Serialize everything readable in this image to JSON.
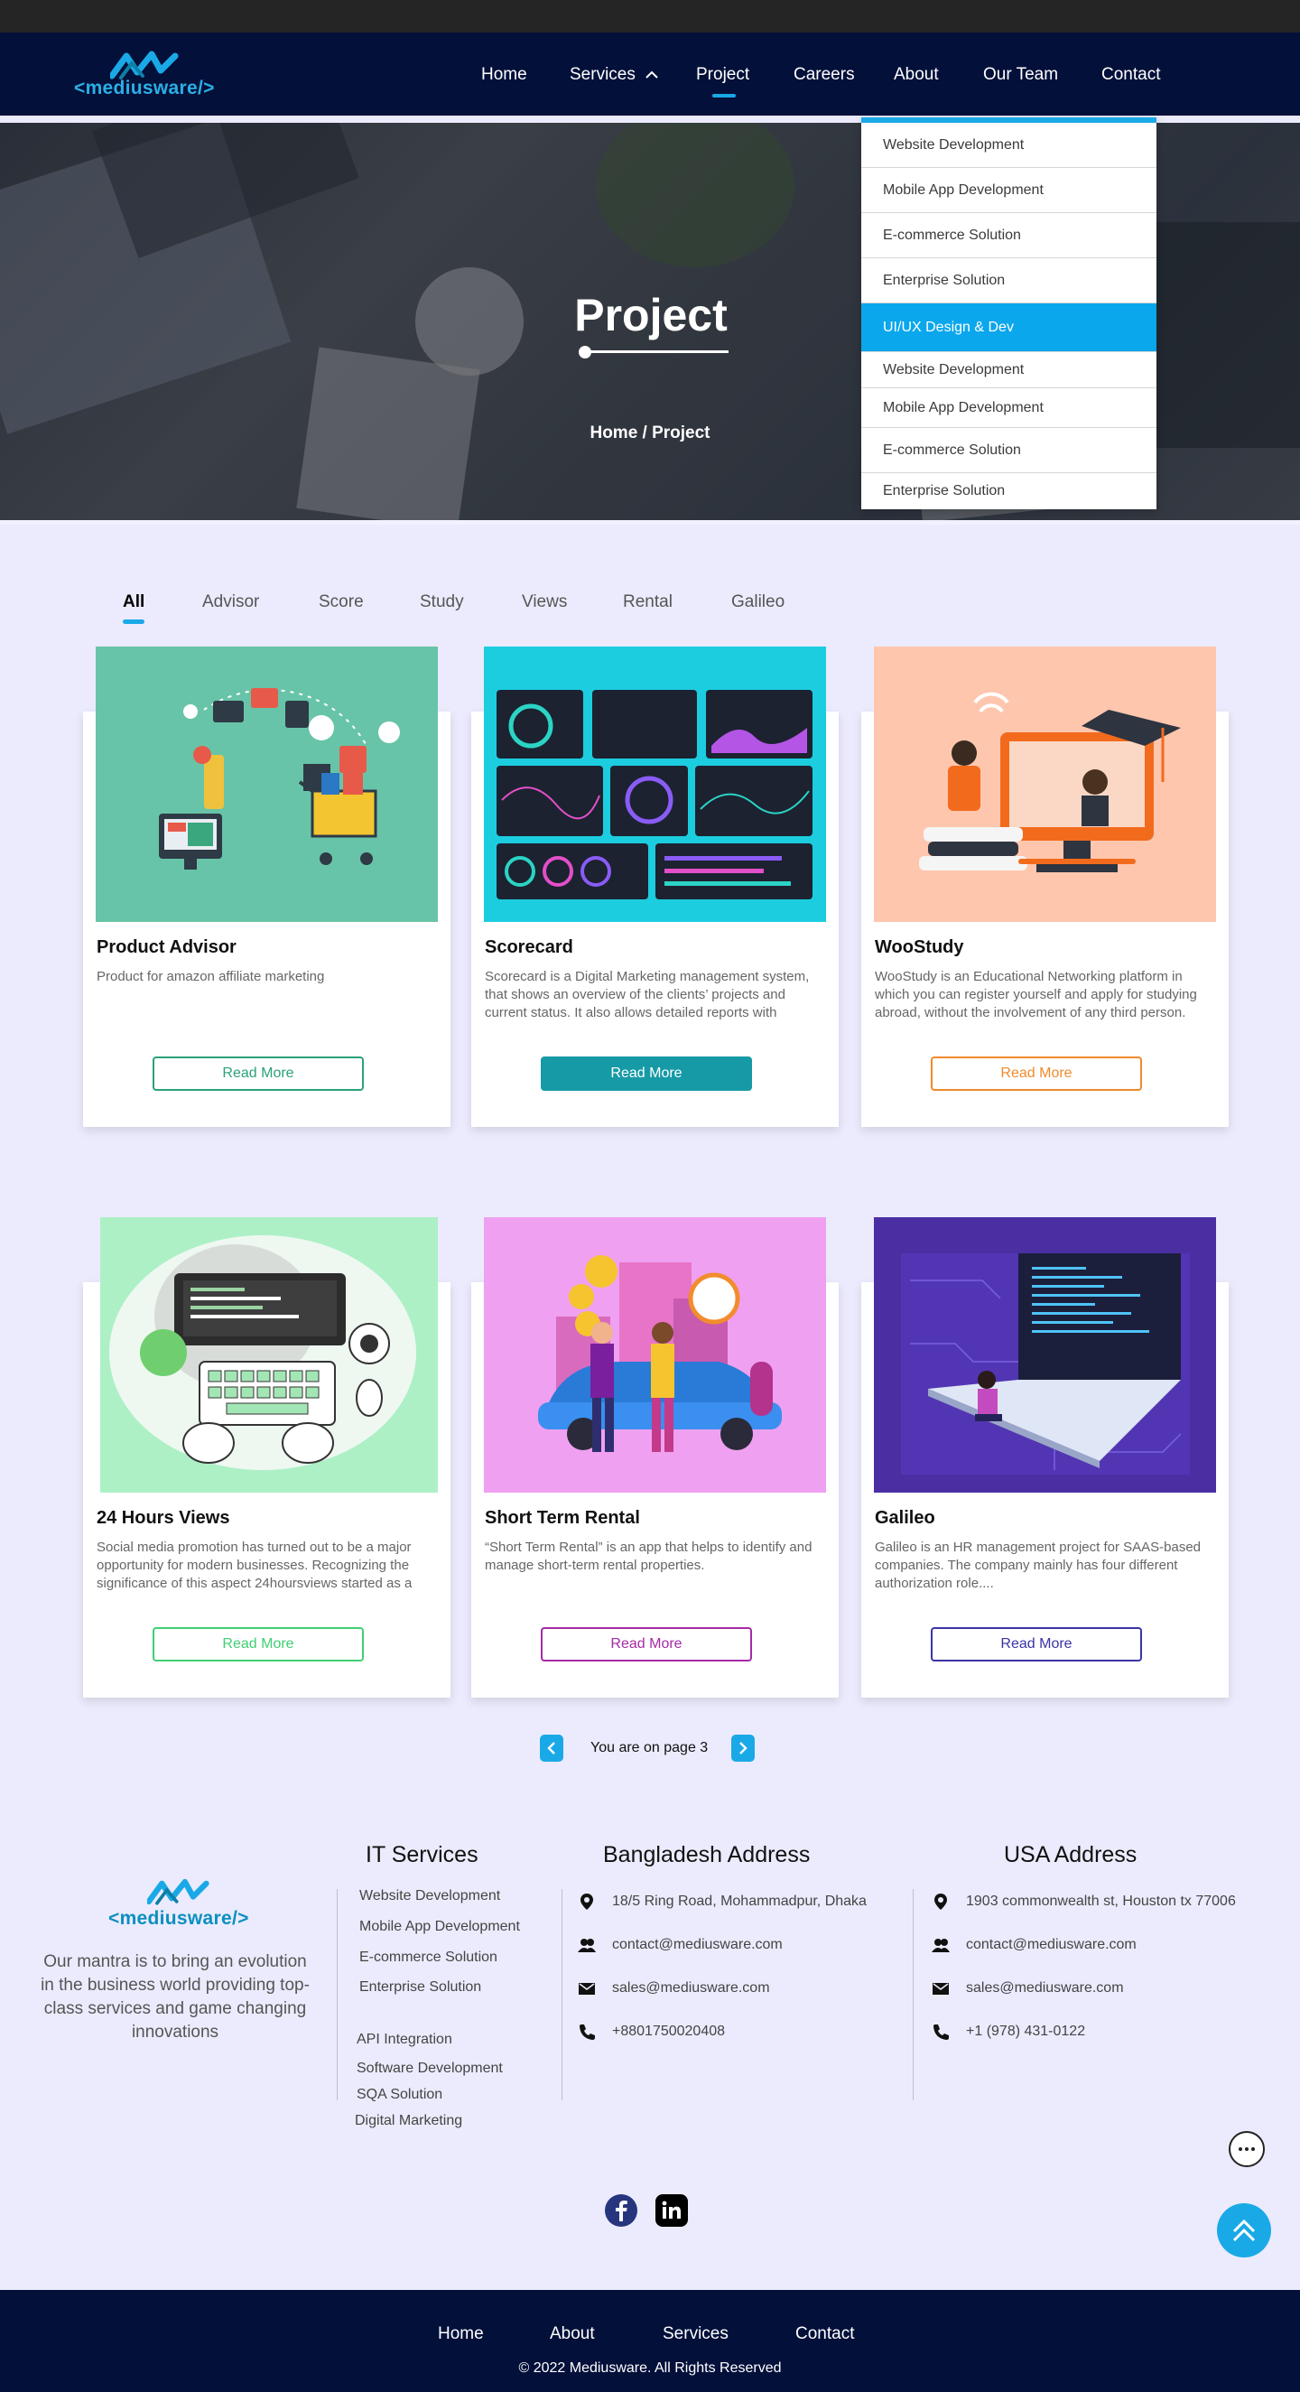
{
  "brand": {
    "logo_text": "<mediusware/>",
    "accent": "#1aa9e7",
    "nav_bg": "#03103a"
  },
  "nav": {
    "items": [
      "Home",
      "Services",
      "Project",
      "Careers",
      "About",
      "Our Team",
      "Contact"
    ],
    "active": "Project"
  },
  "services_dropdown": {
    "items": [
      "Website Development",
      "Mobile App Development",
      "E-commerce Solution",
      "Enterprise Solution",
      "UI/UX Design & Dev",
      "Website Development",
      "Mobile App Development",
      "E-commerce Solution",
      "Enterprise Solution"
    ],
    "selected": "UI/UX Design & Dev"
  },
  "hero": {
    "title": "Project",
    "breadcrumb": "Home / Project"
  },
  "filters": {
    "items": [
      "All",
      "Advisor",
      "Score",
      "Study",
      "Views",
      "Rental",
      "Galileo"
    ],
    "active": "All"
  },
  "projects": [
    {
      "title": "Product Advisor",
      "desc": "Product for amazon affiliate marketing",
      "button": "Read More",
      "accent": "#2aa27a",
      "image_bg": "#68c4a8",
      "filled": false
    },
    {
      "title": "Scorecard",
      "desc": "Scorecard is a Digital Marketing management system, that shows an overview of the clients’ projects and current status. It also allows detailed reports with",
      "button": "Read More",
      "accent": "#169aa6",
      "image_bg": "#1ccde0",
      "filled": true
    },
    {
      "title": "WooStudy",
      "desc": "WooStudy is an Educational Networking platform in which you can register yourself and apply for studying abroad, without the involvement of any third person.",
      "button": "Read More",
      "accent": "#f08a2c",
      "image_bg": "#ffc6ae",
      "filled": false
    },
    {
      "title": "24 Hours Views",
      "desc": "Social media promotion has turned out to be a major opportunity for modern businesses. Recognizing the significance of this aspect 24hoursviews started as a",
      "button": "Read More",
      "accent": "#3fcf72",
      "image_bg": "#adf0c6",
      "filled": false
    },
    {
      "title": "Short Term Rental",
      "desc": "“Short Term Rental” is an app that helps to identify and manage short-term rental properties.",
      "button": "Read More",
      "accent": "#a62aa6",
      "image_bg": "#f0a0f0",
      "filled": false
    },
    {
      "title": "Galileo",
      "desc": "Galileo is an HR management project for SAAS-based companies. The company mainly has four different authorization role....",
      "button": "Read More",
      "accent": "#3b34a6",
      "image_bg": "#4a2fa3",
      "filled": false
    }
  ],
  "pager": {
    "text": "You are on page 3"
  },
  "footer": {
    "mantra": "Our mantra is to bring an evolution in the business world providing top-class services and game changing innovations",
    "it_services": {
      "heading": "IT Services",
      "items": [
        "Website Development",
        "Mobile App Development",
        "E-commerce Solution",
        "Enterprise Solution",
        "API Integration",
        "Software Development",
        "SQA Solution",
        "Digital Marketing"
      ]
    },
    "bd": {
      "heading": "Bangladesh Address",
      "address": "18/5 Ring Road, Mohammadpur, Dhaka",
      "contact": "contact@mediusware.com",
      "sales": "sales@mediusware.com",
      "phone": "+8801750020408"
    },
    "usa": {
      "heading": "USA Address",
      "address": "1903 commonwealth st, Houston tx 77006",
      "contact": "contact@mediusware.com",
      "sales": "sales@mediusware.com",
      "phone": "+1 (978) 431-0122"
    },
    "social": [
      "facebook-icon",
      "linkedin-icon"
    ],
    "bottom_links": [
      "Home",
      "About",
      "Services",
      "Contact"
    ],
    "copyright": "© 2022 Mediusware. All Rights Reserved"
  }
}
